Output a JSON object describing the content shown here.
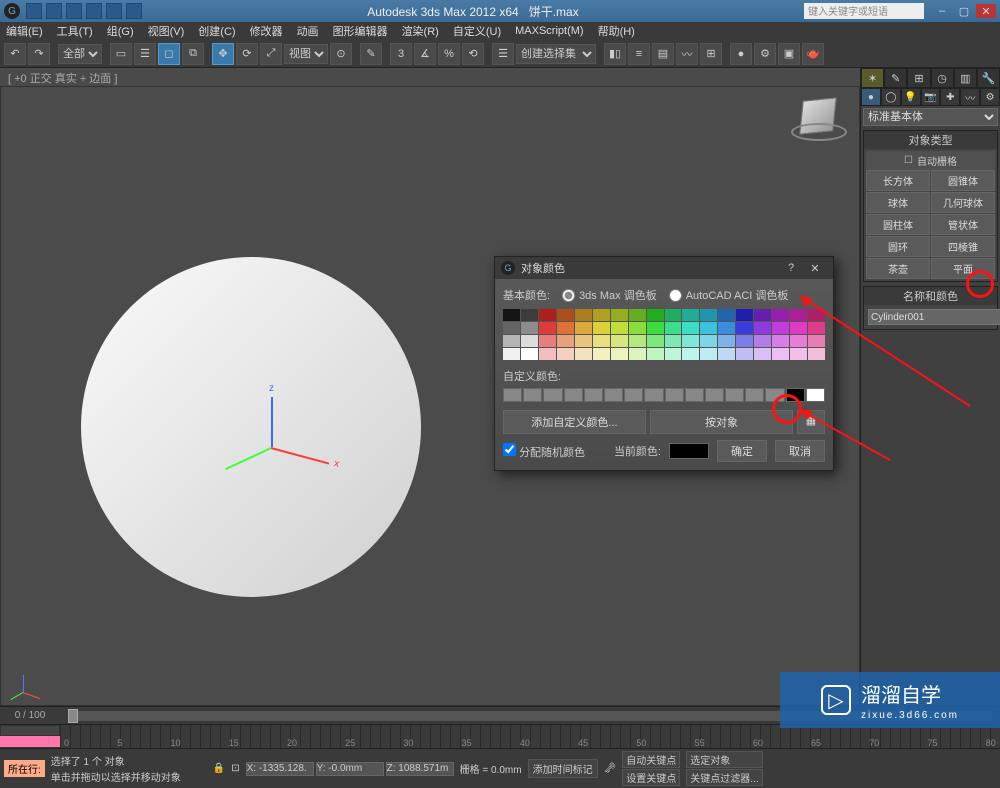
{
  "title": "Autodesk 3ds Max 2012 x64",
  "filename": "饼干.max",
  "search_placeholder": "键入关键字或短语",
  "menu": [
    "编辑(E)",
    "工具(T)",
    "组(G)",
    "视图(V)",
    "创建(C)",
    "修改器",
    "动画",
    "图形编辑器",
    "渲染(R)",
    "自定义(U)",
    "MAXScript(M)",
    "帮助(H)"
  ],
  "toolbar": {
    "all": "全部",
    "view": "视图",
    "selset": "创建选择集"
  },
  "viewport_label": "[ +0 正交 真实 + 边面 ]",
  "panel": {
    "dropdown": "标准基本体",
    "rollout_objtype": "对象类型",
    "autogrid": "自动栅格",
    "objs": [
      "长方体",
      "圆锥体",
      "球体",
      "几何球体",
      "圆柱体",
      "管状体",
      "圆环",
      "四棱锥",
      "茶壶",
      "平面"
    ],
    "rollout_name": "名称和颜色",
    "name": "Cylinder001"
  },
  "dialog": {
    "title": "对象颜色",
    "basic": "基本颜色:",
    "opt1": "3ds Max 调色板",
    "opt2": "AutoCAD ACI 调色板",
    "custom": "自定义颜色:",
    "add": "添加自定义颜色...",
    "byobj": "按对象",
    "assign_random": "分配随机颜色",
    "current": "当前颜色:",
    "ok": "确定",
    "cancel": "取消"
  },
  "timeline": {
    "frame": "0 / 100"
  },
  "status": {
    "sel": "选择了 1 个 对象",
    "hint": "单击并拖动以选择并移动对象",
    "now": "所在行:",
    "add_tag": "添加时间标记",
    "x": "X: -1335.128.",
    "y": "Y: -0.0mm",
    "z": "Z: 1088.571m",
    "grid": "栅格 = 0.0mm",
    "autokey": "自动关键点",
    "selset2": "选定对象",
    "setkey": "设置关键点",
    "keyfilter": "关键点过滤器..."
  },
  "watermark": {
    "main": "溜溜自学",
    "sub": "zixue.3d66.com"
  },
  "ticks": [
    "0",
    "5",
    "10",
    "15",
    "20",
    "25",
    "30",
    "35",
    "40",
    "45",
    "50",
    "55",
    "60",
    "65",
    "70",
    "75",
    "80"
  ]
}
